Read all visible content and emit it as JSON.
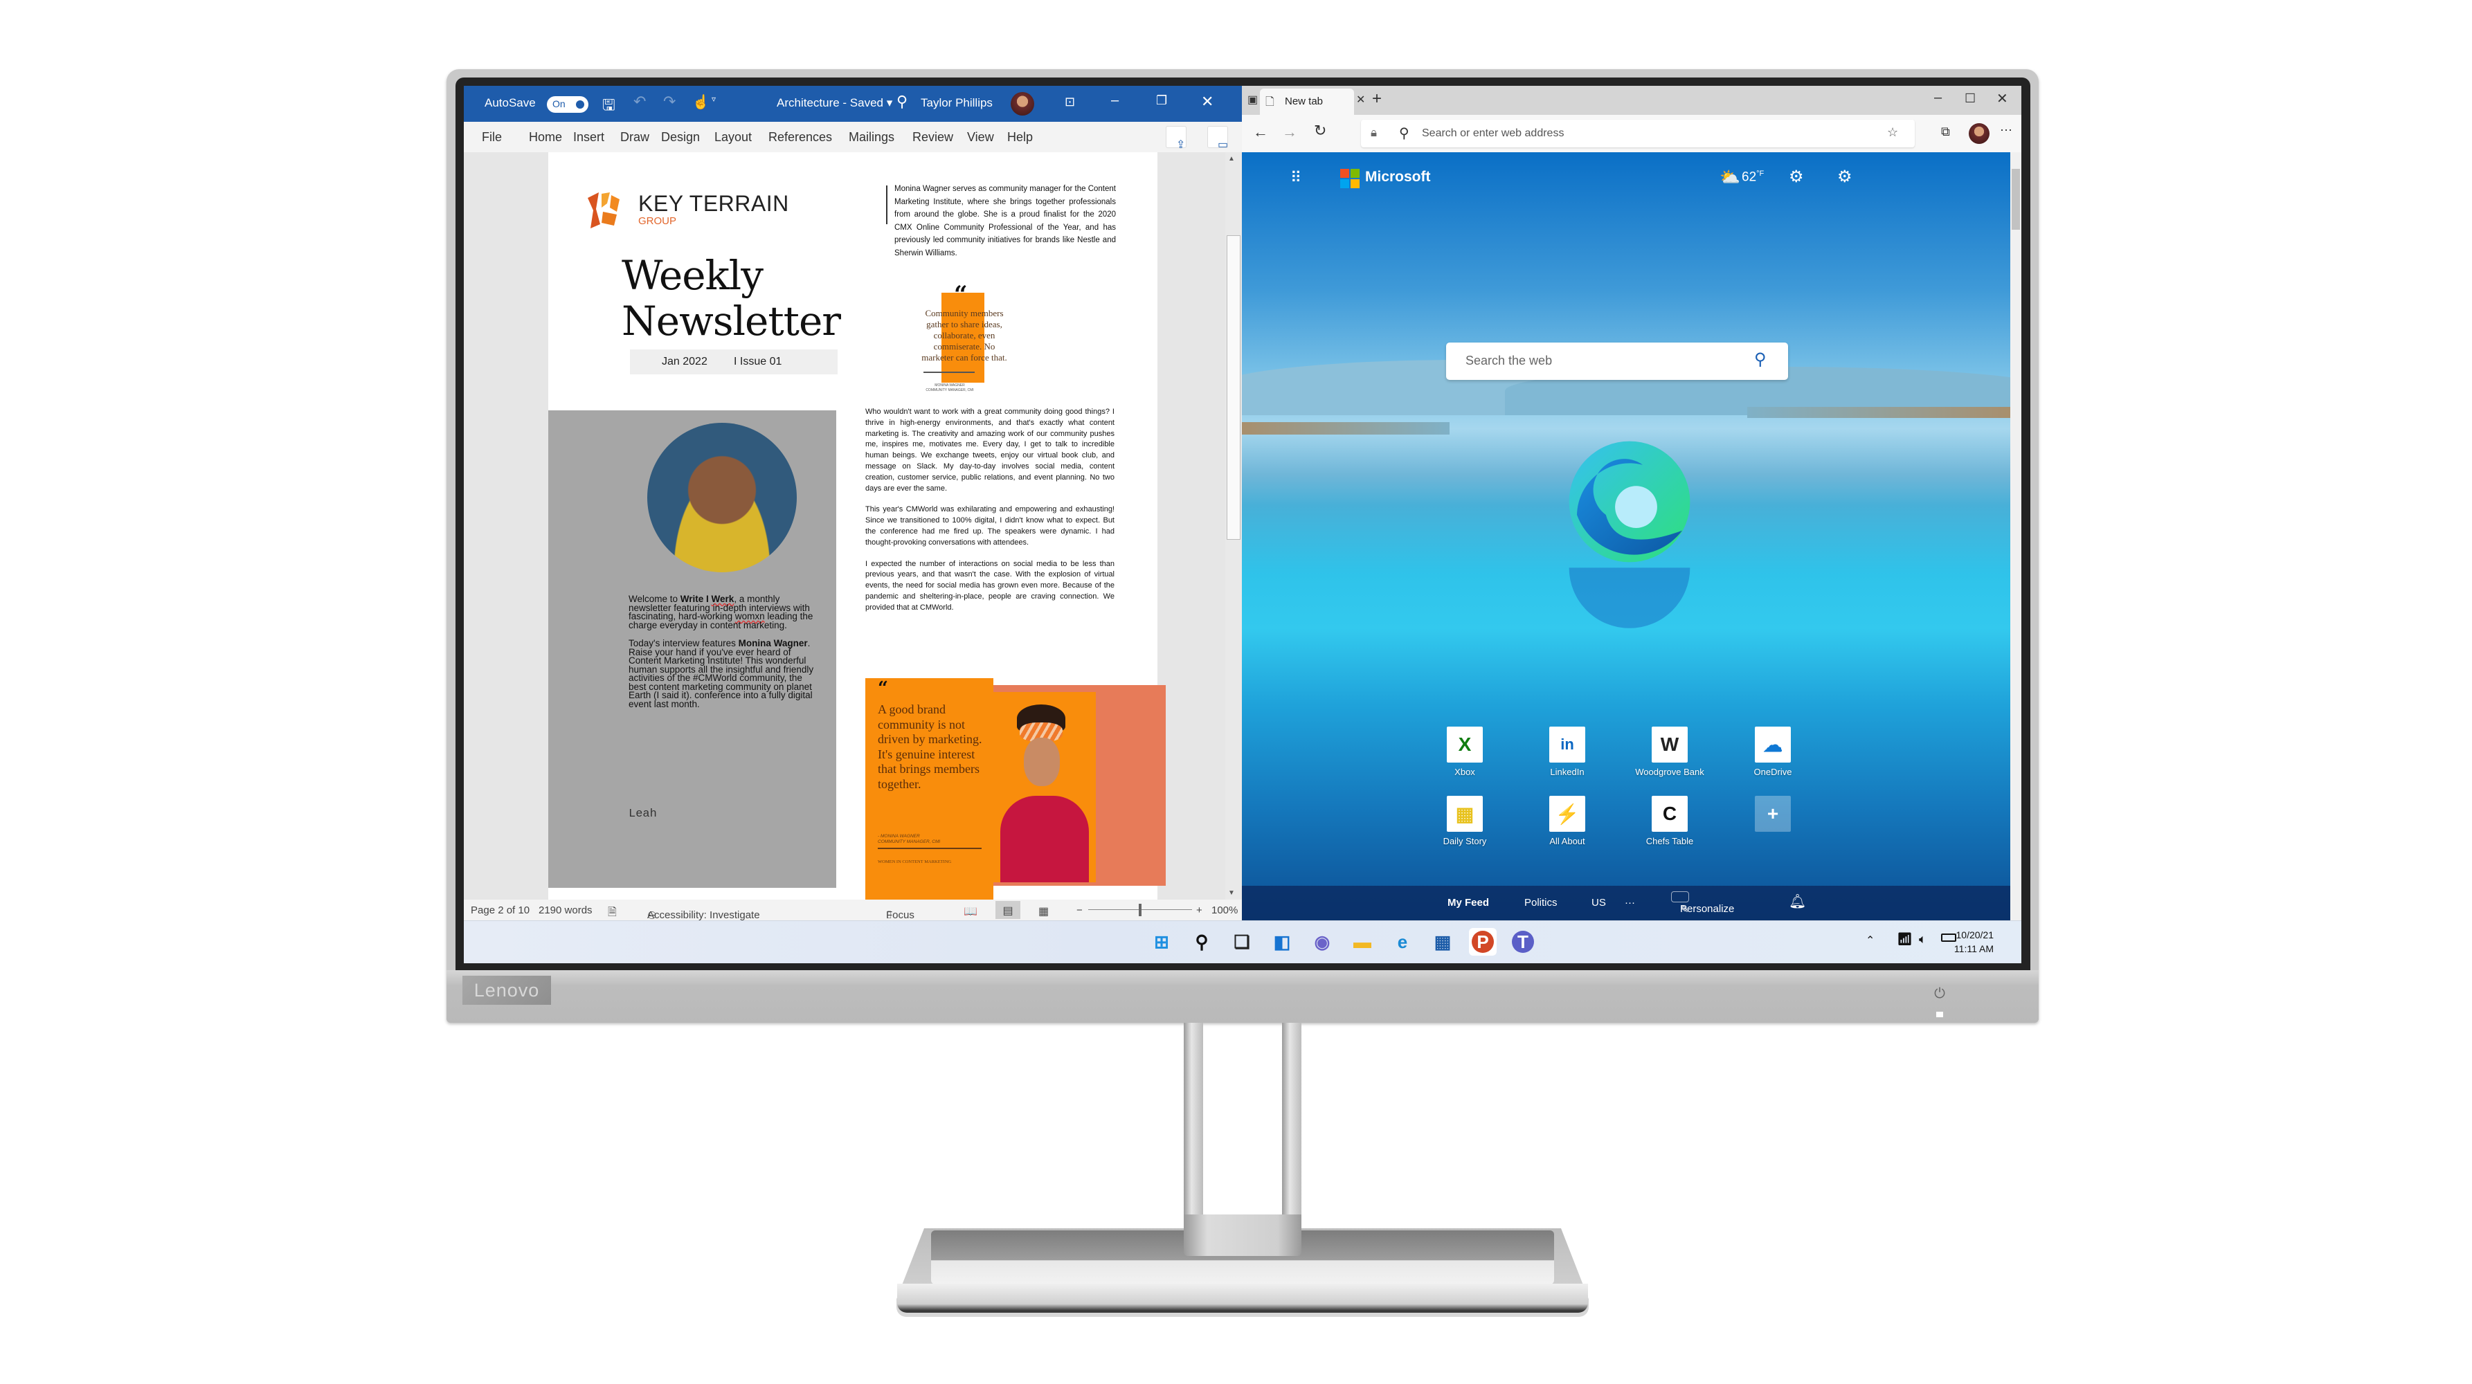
{
  "device": {
    "brand": "Lenovo"
  },
  "word": {
    "autosave_label": "AutoSave",
    "autosave_state": "On",
    "doc_title": "Architecture - Saved",
    "user_name": "Taylor Phillips",
    "menu": [
      "File",
      "Home",
      "Insert",
      "Draw",
      "Design",
      "Layout",
      "References",
      "Mailings",
      "Review",
      "View",
      "Help"
    ],
    "status": {
      "page": "Page 2 of 10",
      "words": "2190 words",
      "accessibility": "Accessibility: Investigate",
      "focus": "Focus",
      "zoom": "100%",
      "zoom_level_percent": 100
    },
    "document": {
      "company": "KEY TERRAIN",
      "company_sub": "GROUP",
      "title_line1": "Weekly",
      "title_line2": "Newsletter",
      "date": "Jan 2022",
      "issue": "I  Issue 01",
      "bio": "Monina Wagner serves as community manager for the Content Marketing Institute, where she brings together professionals from around the globe. She is a proud finalist for the 2020 CMX Online Community Professional of the Year, and has previously led community initiatives for brands like Nestle and Sherwin Williams.",
      "quote1": "Community members gather to share ideas, collaborate, even commiserate. No marketer can force that.",
      "quote1_attr_name": "MONINA WAGNER",
      "quote1_attr_role": "COMMUNITY MANAGER, CMI",
      "welcome_pre": "Welcome to ",
      "welcome_bold1": "Write I ",
      "welcome_bold2": "Werk",
      "welcome_mid": ", a monthly newsletter featuring in-depth interviews with fascinating, hard-working ",
      "welcome_sq": "womxn",
      "welcome_post": " leading the charge everyday in content marketing.",
      "today_pre": "Today's interview features ",
      "today_bold": "Monina Wagner",
      "today_post": ". Raise your hand if you've ever heard of Content Marketing Institute! This wonderful human supports all the insightful and friendly activities of the #CMWorld community, the best content marketing community on planet Earth (I said it). conference into a fully digital event last month.",
      "signature": "Leah",
      "body": [
        "Who wouldn't want to work with a great community doing good things? I thrive in high-energy environments, and that's exactly what content marketing is. The creativity and amazing work of our community pushes me, inspires me, motivates me. Every day, I get to talk to incredible human beings. We exchange tweets, enjoy our virtual book club, and message on Slack. My day-to-day involves social media, content creation, customer service, public relations, and event planning. No two days are ever the same.",
        "This year's CMWorld was exhilarating and empowering and exhausting! Since we transitioned to 100% digital, I didn't know what to expect. But the conference had me fired up. The speakers were dynamic. I had thought-provoking conversations with attendees.",
        " I expected the number of interactions on social media to be less than previous years, and that wasn't the case. With the explosion of virtual events, the need for social media has grown even more. Because of the pandemic and sheltering-in-place, people are craving connection. We provided that at CMWorld."
      ],
      "quote2": "A good brand community is not driven by marketing. It's genuine interest that brings members together.",
      "quote2_attr_name": "- MONINA WAGNER",
      "quote2_attr_role": "COMMUNITY MANAGER, CMI",
      "quote2_footer": "WOMEN IN CONTENT MARKETING"
    }
  },
  "edge": {
    "tab_title": "New tab",
    "address_placeholder": "Search or enter web address",
    "brand": "Microsoft",
    "weather": "62",
    "weather_unit": "°F",
    "search_placeholder": "Search the web",
    "tiles": [
      {
        "label": "Xbox",
        "glyph": "X",
        "color": "#107c10"
      },
      {
        "label": "LinkedIn",
        "glyph": "in",
        "color": "#0a66c2"
      },
      {
        "label": "Woodgrove Bank",
        "glyph": "W",
        "color": "#222222"
      },
      {
        "label": "OneDrive",
        "glyph": "☁",
        "color": "#0f78d4"
      },
      {
        "label": "Daily Story",
        "glyph": "▦",
        "color": "#e8c21e"
      },
      {
        "label": "All About",
        "glyph": "⚡",
        "color": "#f5a623"
      },
      {
        "label": "Chefs Table",
        "glyph": "C",
        "color": "#111111"
      },
      {
        "label": "",
        "glyph": "+",
        "color": "#ffffff"
      }
    ],
    "feed": [
      "My Feed",
      "Politics",
      "US",
      "···"
    ],
    "personalize": "Personalize"
  },
  "taskbar": {
    "apps": [
      "Start",
      "Search",
      "Task View",
      "Widgets",
      "Chat",
      "File Explorer",
      "Edge",
      "Microsoft Store",
      "PowerPoint",
      "Teams"
    ],
    "date": "10/20/21",
    "time": "11:11 AM"
  }
}
